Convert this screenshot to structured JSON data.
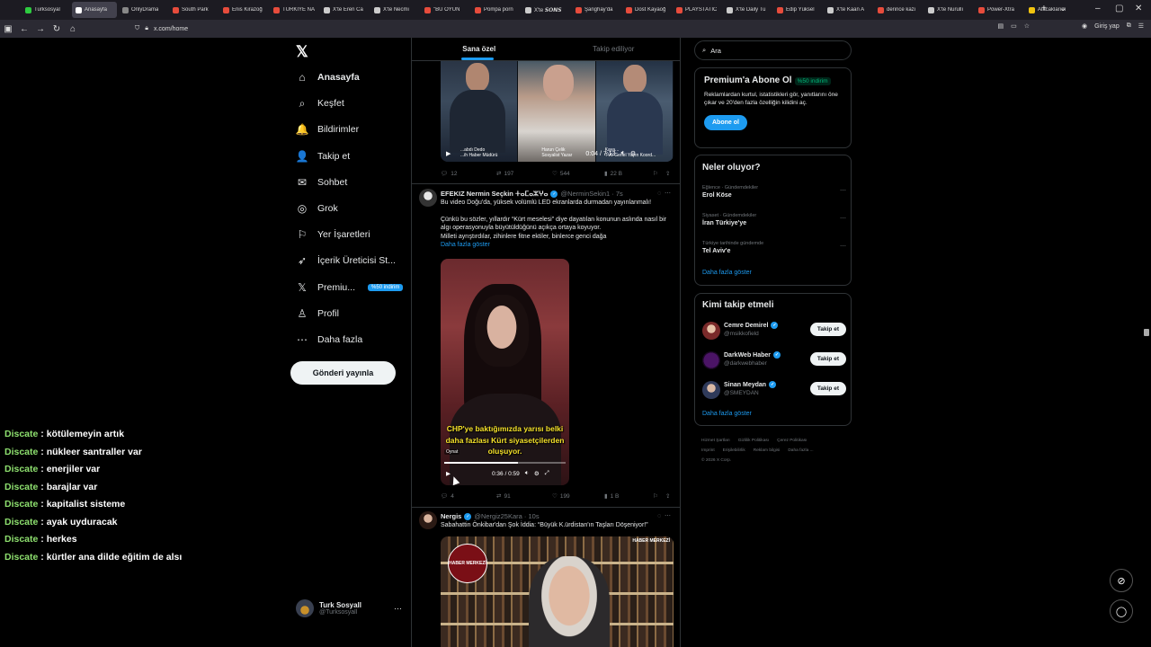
{
  "browser": {
    "tabs": [
      {
        "title": "Turksosyal",
        "color": "#2ecc40"
      },
      {
        "title": "Anasayfa",
        "color": "#ffffff",
        "active": true
      },
      {
        "title": "OnlyDrama",
        "color": "#888888"
      },
      {
        "title": "South Park",
        "color": "#e74c3c"
      },
      {
        "title": "Enis Kirazoğ",
        "color": "#e74c3c"
      },
      {
        "title": "TÜRKİYE NA",
        "color": "#e74c3c"
      },
      {
        "title": "X'te Eren Ca",
        "color": "#cccccc"
      },
      {
        "title": "X'te Necmi",
        "color": "#cccccc"
      },
      {
        "title": "\"BU OYUN",
        "color": "#e74c3c"
      },
      {
        "title": "Pompa porn",
        "color": "#e74c3c"
      },
      {
        "title": "X'te 𝙎𝙊𝙉𝙎",
        "color": "#cccccc"
      },
      {
        "title": "Şanghay'da",
        "color": "#e74c3c"
      },
      {
        "title": "Dost Kayaoğ",
        "color": "#e74c3c"
      },
      {
        "title": "PLAYSTATIC",
        "color": "#e74c3c"
      },
      {
        "title": "X'te Daily Tu",
        "color": "#cccccc"
      },
      {
        "title": "Edip Yüksel",
        "color": "#e74c3c"
      },
      {
        "title": "X'te Kaan A",
        "color": "#cccccc"
      },
      {
        "title": "derince kazı",
        "color": "#e74c3c"
      },
      {
        "title": "X'te Nurullı",
        "color": "#cccccc"
      },
      {
        "title": "Power-Xtra",
        "color": "#e74c3c"
      },
      {
        "title": "Alacaklarım",
        "color": "#f1c40f"
      }
    ],
    "url": "x.com/home",
    "signin_label": "Giriş yap"
  },
  "sidebar": {
    "logo": "𝕏",
    "items": [
      {
        "label": "Anasayfa",
        "icon": "⌂"
      },
      {
        "label": "Keşfet",
        "icon": "⌕"
      },
      {
        "label": "Bildirimler",
        "icon": "🔔"
      },
      {
        "label": "Takip et",
        "icon": "👤"
      },
      {
        "label": "Sohbet",
        "icon": "✉"
      },
      {
        "label": "Grok",
        "icon": "◎"
      },
      {
        "label": "Yer İşaretleri",
        "icon": "⚐"
      },
      {
        "label": "İçerik Üreticisi St...",
        "icon": "➶"
      },
      {
        "label": "Premiu...",
        "icon": "𝕏",
        "badge": "%50 indirim"
      },
      {
        "label": "Profil",
        "icon": "♙"
      },
      {
        "label": "Daha fazla",
        "icon": "⋯"
      }
    ],
    "post_button": "Gönderi yayınla",
    "account": {
      "name": "Turk Sosyall",
      "handle": "@Turksosyall"
    }
  },
  "chat": [
    {
      "user": "Discate",
      "text": ": kötülemeyin artık"
    },
    {
      "user": "Discate",
      "text": ": nükleer santraller var"
    },
    {
      "user": "Discate",
      "text": ": enerjiler var"
    },
    {
      "user": "Discate",
      "text": ": barajlar var"
    },
    {
      "user": "Discate",
      "text": ": kapitalist sisteme"
    },
    {
      "user": "Discate",
      "text": ": ayak uyduracak"
    },
    {
      "user": "Discate",
      "text": ": herkes"
    },
    {
      "user": "Discate",
      "text": ": kürtler ana dilde eğitim de alsı"
    }
  ],
  "feed": {
    "tabs": [
      "Sana özel",
      "Takip ediliyor"
    ],
    "post1": {
      "video_time": "0:04 / 7:13",
      "caption_left": "...abdı Dedo\n...ih Haber Müdürü",
      "caption_mid": "Harun Çelik\nSosyalist Yazar",
      "caption_right": "Kaya...\nTV5 Genel Yayın Koord...",
      "replies": "12",
      "reposts": "197",
      "likes": "544",
      "views": "22 B"
    },
    "post2": {
      "name": "EFEKIZ Nermin Seçkin ⵜⴰⵎⴰⵣⵖⴰ",
      "handle": "@NerminSekin1 · 7s",
      "text1": "Bu video Doğu'da, yüksek volümlü LED ekranlarda durmadan yayınlanmalı!",
      "text2": "Çünkü bu sözler, yıllardır “Kürt meselesi” diye dayatılan konunun aslında nasıl bir algı operasyonuyla büyütüldüğünü açıkça ortaya koyuyor.",
      "text3": "Milleti ayrıştırdılar, zihinlere fitne ektiler, binlerce genci dağa",
      "more": "Daha fazla göster",
      "subtitle": "CHP'ye baktığımızda yarısı belki daha fazlası Kürt siyasetçilerden oluşuyor.",
      "tag": "Oynat",
      "video_time": "0:36 / 0:59",
      "progress": 0.61,
      "replies": "4",
      "reposts": "91",
      "likes": "199",
      "views": "1 B"
    },
    "post3": {
      "name": "Nergis",
      "handle": "@Nergiz25Kara · 10s",
      "text": "Sabahattin Önkibar'dan Şok İddia: “Büyük K.ürdistan'ın Taşları Döşeniyor!”",
      "logo": "HABER MERKEZİ",
      "brand": "HABER MERKEZİ"
    }
  },
  "right": {
    "search_placeholder": "Ara",
    "premium": {
      "title": "Premium'a Abone Ol",
      "badge": "%50 indirim",
      "body": "Reklamlardan kurtul, istatistikleri gör, yanıtlarını öne çıkar ve 20'den fazla özelliğin kilidini aç.",
      "button": "Abone ol"
    },
    "trends": {
      "title": "Neler oluyor?",
      "items": [
        {
          "cat": "Eğlence · Gündemdekiler",
          "title": "Erol Köse"
        },
        {
          "cat": "Siyaset · Gündemdekiler",
          "title": "İran Türkiye'ye"
        },
        {
          "cat": "Türkiye tarihinde gündemde",
          "title": "Tel Aviv'e"
        }
      ],
      "more": "Daha fazla göster"
    },
    "who": {
      "title": "Kimi takip etmeli",
      "items": [
        {
          "name": "Cemre Demirel",
          "handle": "@msikkofield",
          "button": "Takip et"
        },
        {
          "name": "DarkWeb Haber",
          "handle": "@darkwebhaber",
          "button": "Takip et"
        },
        {
          "name": "Sinan Meydan",
          "handle": "@SMEYDAN",
          "button": "Takip et"
        }
      ],
      "more": "Daha fazla göster"
    },
    "footer": [
      "Hizmet Şartları",
      "Gizlilik Politikası",
      "Çerez Politikası",
      "Imprint",
      "Erişilebilirlik",
      "Reklam bilgisi",
      "Daha fazla ...",
      "© 2026 X Corp."
    ]
  }
}
